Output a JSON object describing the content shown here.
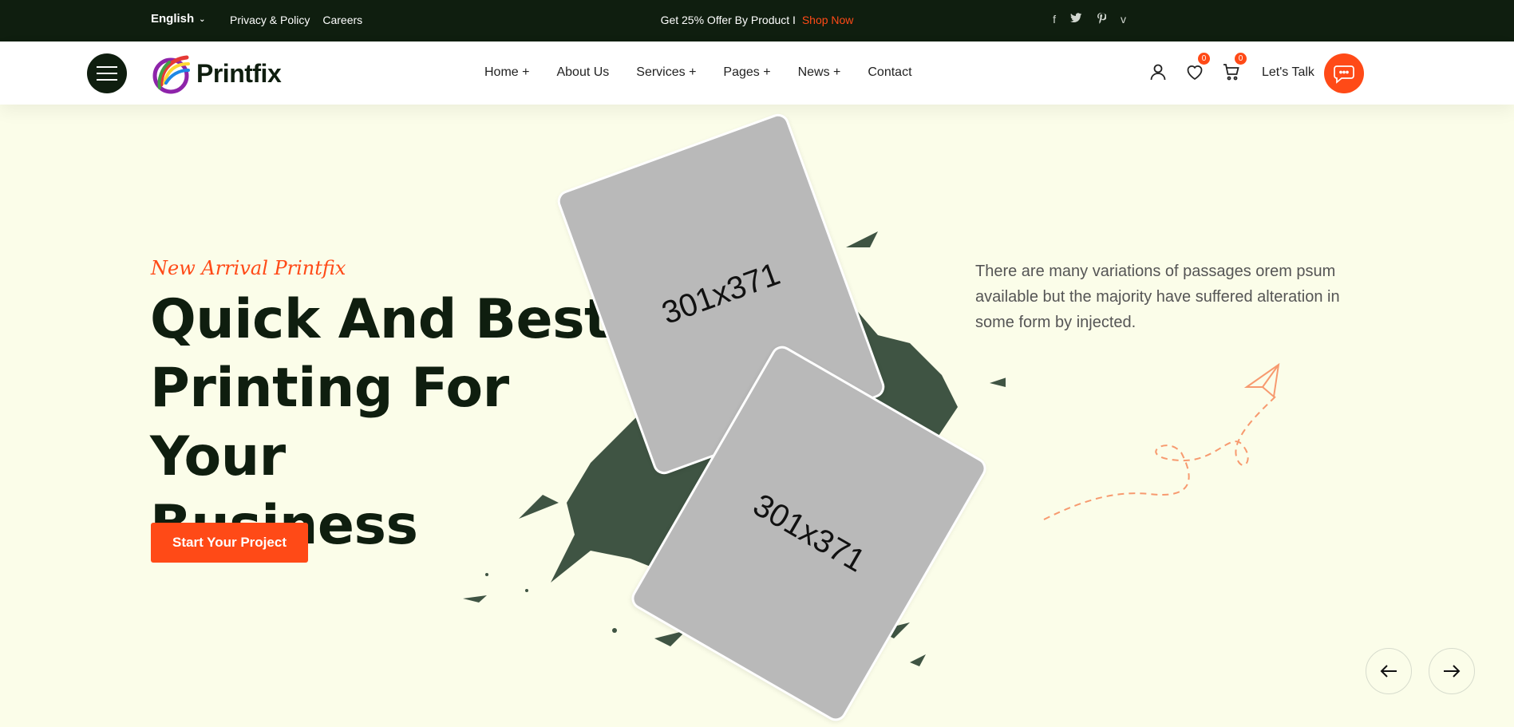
{
  "topbar": {
    "language": "English",
    "links": [
      "Privacy & Policy",
      "Careers"
    ],
    "offer_text": "Get 25% Offer By Product I",
    "offer_link": "Shop Now",
    "social": [
      "f",
      "t",
      "p",
      "v"
    ]
  },
  "header": {
    "brand": "Printfix",
    "nav": [
      "Home +",
      "About Us",
      "Services +",
      "Pages +",
      "News +",
      "Contact"
    ],
    "wishlist_count": "0",
    "cart_count": "0",
    "lets_talk": "Let's Talk"
  },
  "hero": {
    "tagline": "New Arrival Printfix",
    "title_line1": "Quick And Best",
    "title_line2": "Printing For Your",
    "title_line3": "Business",
    "cta_label": "Start Your Project",
    "description": "There are many variations of passages orem psum available but the majority have suffered alteration in some form by injected.",
    "card1_label": "301x371",
    "card2_label": "301x371"
  },
  "colors": {
    "accent": "#ff4a17",
    "dark": "#0f1e0f",
    "hero_bg": "#fbfde9",
    "splash": "#3f5443"
  },
  "icons": {
    "menu": "hamburger-icon",
    "user": "user-icon",
    "wishlist": "heart-icon",
    "cart": "cart-icon",
    "chat": "chat-icon",
    "prev": "arrow-left-icon",
    "next": "arrow-right-icon"
  }
}
